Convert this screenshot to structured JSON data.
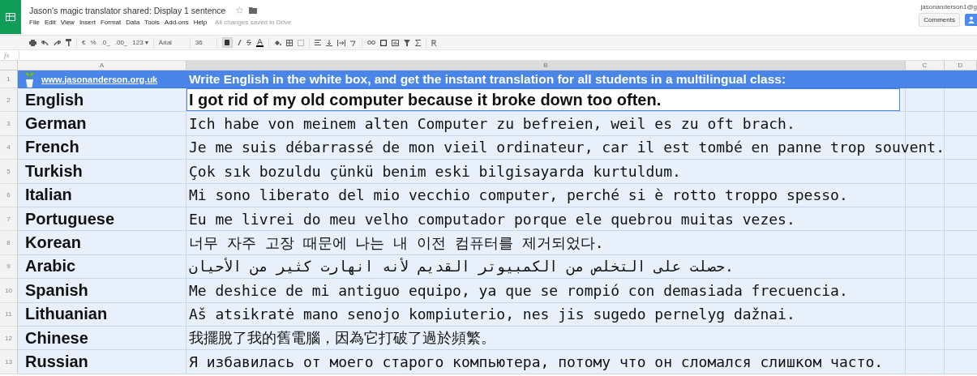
{
  "document": {
    "title": "Jason's magic translator shared: Display 1 sentence",
    "starred": false,
    "save_status": "All changes saved in Drive"
  },
  "menu": [
    "File",
    "Edit",
    "View",
    "Insert",
    "Format",
    "Data",
    "Tools",
    "Add-ons",
    "Help"
  ],
  "account": {
    "email": "jasonanderson1@g",
    "comments_label": "Comments"
  },
  "toolbar": {
    "currency": "€",
    "percent": "%",
    "decrease_decimals": ".0_",
    "increase_decimals": ".00_",
    "more_formats": "123 ▾",
    "font": "Arial",
    "font_size": "36",
    "bold_on": true
  },
  "formula_bar": {
    "label": "fx"
  },
  "columns": [
    {
      "label": "A",
      "selected": false
    },
    {
      "label": "B",
      "selected": true
    },
    {
      "label": "C",
      "selected": false
    },
    {
      "label": "D",
      "selected": false
    }
  ],
  "header_row": {
    "number": "1",
    "link": "www.jasonanderson.org.uk",
    "instruction": "Write English in the white box, and get the instant translation for all students in a multilingual class:"
  },
  "rows": [
    {
      "number": "2",
      "language": "English",
      "kind": "input",
      "text": "I got rid of my old computer because it broke down too often."
    },
    {
      "number": "3",
      "language": "German",
      "kind": "translation",
      "text": "Ich habe von meinem alten Computer zu befreien, weil es zu oft brach."
    },
    {
      "number": "4",
      "language": "French",
      "kind": "translation",
      "text": "Je me suis débarrassé de mon vieil ordinateur, car il est tombé en panne trop souvent."
    },
    {
      "number": "5",
      "language": "Turkish",
      "kind": "translation",
      "text": "Çok sık bozuldu çünkü benim eski bilgisayarda kurtuldum."
    },
    {
      "number": "6",
      "language": "Italian",
      "kind": "translation",
      "text": "Mi sono liberato del mio vecchio computer, perché si è rotto troppo spesso."
    },
    {
      "number": "7",
      "language": "Portuguese",
      "kind": "translation",
      "text": "Eu me livrei do meu velho computador porque ele quebrou muitas vezes."
    },
    {
      "number": "8",
      "language": "Korean",
      "kind": "translation",
      "text": "너무 자주 고장 때문에 나는 내 이전 컴퓨터를 제거되었다."
    },
    {
      "number": "9",
      "language": "Arabic",
      "kind": "translation",
      "text": "حصلت على التخلص من الكمبيوتر القديم لأنه انهارت كثير من الأحيان."
    },
    {
      "number": "10",
      "language": "Spanish",
      "kind": "translation",
      "text": "Me deshice de mi antiguo equipo, ya que se rompió con demasiada frecuencia."
    },
    {
      "number": "11",
      "language": "Lithuanian",
      "kind": "translation",
      "text": "Aš atsikratė mano senojo kompiuterio, nes jis sugedo pernelyg dažnai."
    },
    {
      "number": "12",
      "language": "Chinese",
      "kind": "translation",
      "text": "我擺脫了我的舊電腦，因為它打破了過於頻繁。"
    },
    {
      "number": "13",
      "language": "Russian",
      "kind": "translation",
      "text": "Я избавилась от моего старого компьютера, потому что он сломался слишком часто."
    }
  ]
}
